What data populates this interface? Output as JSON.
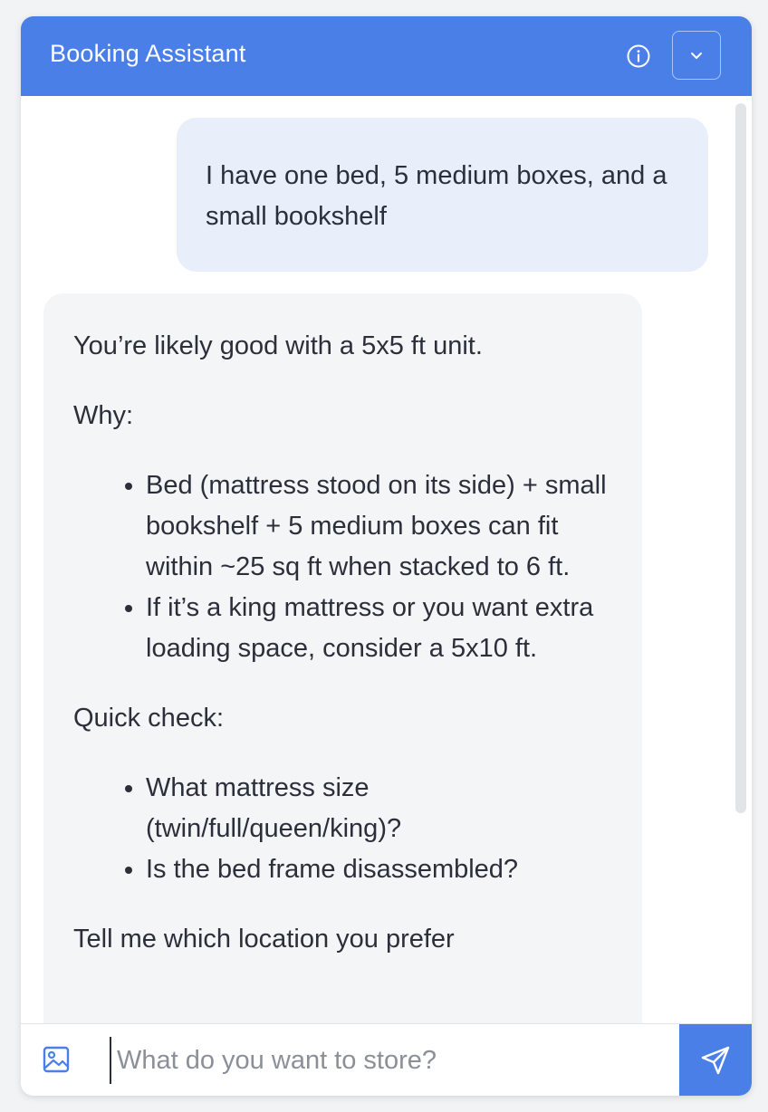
{
  "header": {
    "title": "Booking Assistant",
    "info_icon": "info-icon",
    "collapse_icon": "chevron-down-icon"
  },
  "messages": {
    "user": "I have one bed, 5 medium boxes, and a small bookshelf",
    "bot": {
      "intro": "You’re likely good with a 5x5 ft unit.",
      "why_heading": "Why:",
      "why_items": [
        "Bed (mattress stood on its side) + small bookshelf + 5 medium boxes can fit within ~25 sq ft when stacked to 6 ft.",
        "If it’s a king mattress or you want extra loading space, consider a 5x10 ft."
      ],
      "check_heading": "Quick check:",
      "check_items": [
        "What mattress size (twin/full/queen/king)?",
        "Is the bed frame disassembled?"
      ],
      "closing": "Tell me which location you prefer"
    }
  },
  "composer": {
    "placeholder": "What do you want to store?",
    "image_icon": "image-icon",
    "send_icon": "send-icon"
  },
  "colors": {
    "accent": "#4a7fe8",
    "user_bubble": "#e8effb",
    "bot_bubble": "#f4f5f7"
  }
}
